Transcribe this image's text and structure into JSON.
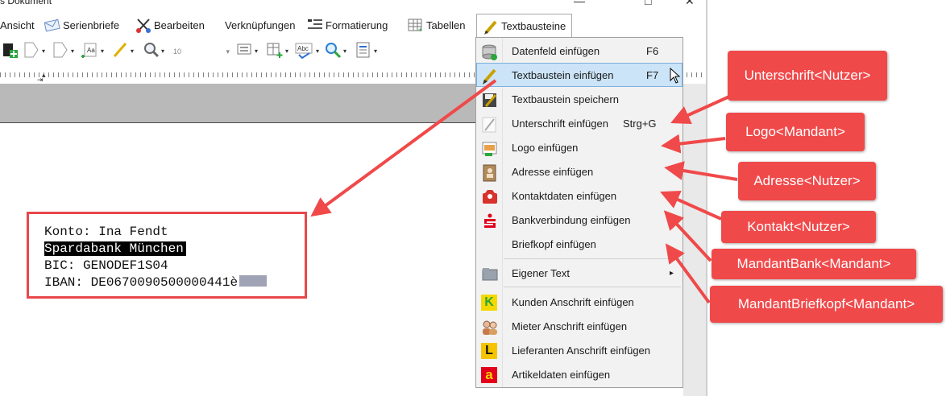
{
  "window": {
    "title": "s Dokument",
    "controls": [
      "—",
      "□",
      "✕"
    ]
  },
  "ribbon": {
    "tabs": [
      {
        "label": "Ansicht",
        "icon": "none"
      },
      {
        "label": "Serienbriefe",
        "icon": "envelope-icon"
      },
      {
        "label": "Bearbeiten",
        "icon": "scissors-icon"
      },
      {
        "label": "Verknüpfungen",
        "icon": "none"
      },
      {
        "label": "Formatierung",
        "icon": "format-icon"
      },
      {
        "label": "Tabellen",
        "icon": "table-icon"
      },
      {
        "label": "Textbausteine",
        "icon": "pen-icon"
      }
    ],
    "active_tab": "Textbausteine"
  },
  "toolbar": {
    "font_size_value": "10"
  },
  "document": {
    "lines": [
      {
        "text": "Konto: Ina Fendt"
      },
      {
        "text": "Spardabank München"
      },
      {
        "text": "BIC: GENODEF1S04"
      },
      {
        "text": "IBAN: DE0670090500000441è"
      }
    ]
  },
  "menu": {
    "items": [
      {
        "label": "Datenfeld einfügen",
        "shortcut": "F6",
        "icon": "database-icon"
      },
      {
        "label": "Textbaustein einfügen",
        "shortcut": "F7",
        "icon": "pen-icon"
      },
      {
        "label": "Textbaustein speichern",
        "shortcut": "",
        "icon": "save-icon"
      },
      {
        "label": "Unterschrift einfügen",
        "shortcut": "Strg+G",
        "icon": "signature-icon"
      },
      {
        "label": "Logo einfügen",
        "shortcut": "",
        "icon": "image-icon"
      },
      {
        "label": "Adresse einfügen",
        "shortcut": "",
        "icon": "address-book-icon"
      },
      {
        "label": "Kontaktdaten einfügen",
        "shortcut": "",
        "icon": "contact-icon"
      },
      {
        "label": "Bankverbindung einfügen",
        "shortcut": "",
        "icon": "sparkasse-icon"
      },
      {
        "label": "Briefkopf einfügen",
        "shortcut": "",
        "icon": "none"
      },
      {
        "label": "Eigener Text",
        "shortcut": "▸",
        "icon": "folder-icon"
      },
      {
        "label": "Kunden Anschrift einfügen",
        "shortcut": "",
        "icon": "k-icon",
        "letter": "K"
      },
      {
        "label": "Mieter Anschrift einfügen",
        "shortcut": "",
        "icon": "people-icon"
      },
      {
        "label": "Lieferanten Anschrift einfügen",
        "shortcut": "",
        "icon": "l-icon",
        "letter": "L"
      },
      {
        "label": "Artikeldaten einfügen",
        "shortcut": "",
        "icon": "a-icon",
        "letter": "a"
      }
    ],
    "highlighted": "Textbaustein einfügen"
  },
  "annotations": [
    {
      "label": "Unterschrift<Nutzer>"
    },
    {
      "label": "Logo<Mandant>"
    },
    {
      "label": "Adresse<Nutzer>"
    },
    {
      "label": "Kontakt<Nutzer>"
    },
    {
      "label": "MandantBank<Mandant>"
    },
    {
      "label": "MandantBriefkopf<Mandant>"
    }
  ],
  "colors": {
    "annotation_red": "#f0494a",
    "menu_highlight": "#cce4f7",
    "sparkasse_red": "#e2001a",
    "kunden_green": "#2aa63a",
    "lieferanten_yellow": "#f5c400"
  }
}
